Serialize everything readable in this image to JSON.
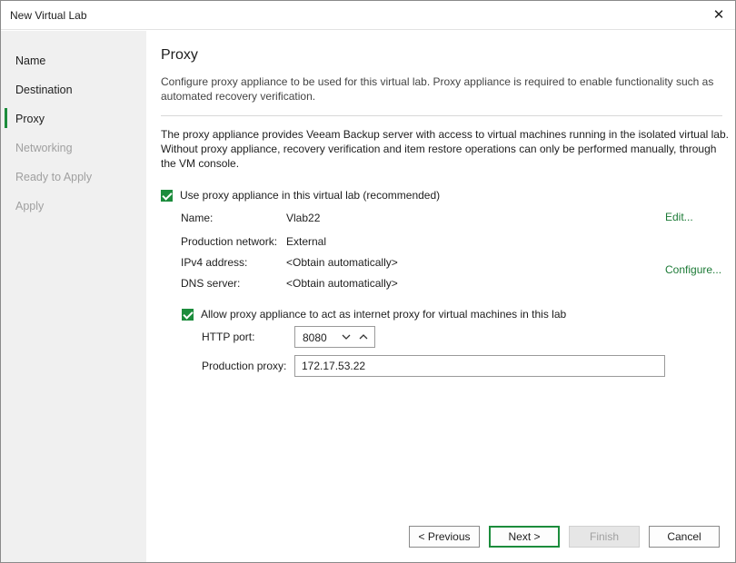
{
  "window": {
    "title": "New Virtual Lab",
    "close_glyph": "✕"
  },
  "sidebar": {
    "steps": [
      {
        "label": "Name",
        "state": "done"
      },
      {
        "label": "Destination",
        "state": "done"
      },
      {
        "label": "Proxy",
        "state": "active"
      },
      {
        "label": "Networking",
        "state": "disabled"
      },
      {
        "label": "Ready to Apply",
        "state": "disabled"
      },
      {
        "label": "Apply",
        "state": "disabled"
      }
    ]
  },
  "page": {
    "title": "Proxy",
    "description": "Configure proxy appliance to be used for this virtual lab. Proxy appliance is required to enable functionality such as automated recovery verification.",
    "info": "The proxy appliance provides Veeam Backup server with access to virtual machines running in the isolated virtual lab. Without proxy appliance, recovery verification and item restore operations can only be performed manually, through the VM console."
  },
  "proxy": {
    "use_label": "Use proxy appliance in this virtual lab (recommended)",
    "use_checked": true,
    "name_label": "Name:",
    "name_value": "Vlab22",
    "network_label": "Production network:",
    "network_value": "External",
    "ipv4_label": "IPv4 address:",
    "ipv4_value": "<Obtain automatically>",
    "dns_label": "DNS server:",
    "dns_value": "<Obtain automatically>",
    "edit_link": "Edit...",
    "configure_link": "Configure..."
  },
  "internet_proxy": {
    "allow_label": "Allow proxy appliance to act as internet proxy for virtual machines in this lab",
    "allow_checked": true,
    "http_port_label": "HTTP port:",
    "http_port_value": "8080",
    "production_proxy_label": "Production proxy:",
    "production_proxy_value": "172.17.53.22"
  },
  "buttons": {
    "previous": "< Previous",
    "next": "Next >",
    "finish": "Finish",
    "cancel": "Cancel"
  },
  "colors": {
    "accent": "#1c8c3c",
    "link": "#1c7a36",
    "sidebar_bg": "#f0f0f0"
  }
}
